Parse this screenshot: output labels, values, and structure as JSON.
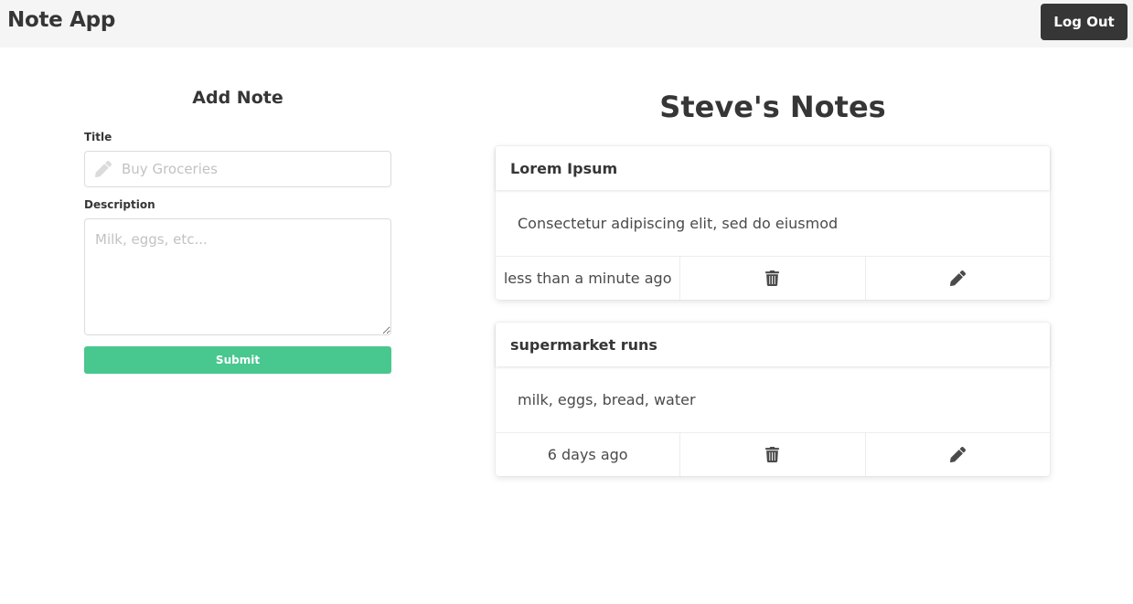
{
  "navbar": {
    "brand": "Note App",
    "logout_label": "Log Out"
  },
  "form": {
    "heading": "Add Note",
    "title_label": "Title",
    "title_placeholder": "Buy Groceries",
    "title_icon": "pencil-icon",
    "description_label": "Description",
    "description_placeholder": "Milk, eggs, etc...",
    "submit_label": "Submit",
    "submit_color": "#48c78e"
  },
  "notes": {
    "heading": "Steve's Notes",
    "items": [
      {
        "title": "Lorem Ipsum",
        "body": "Consectetur adipiscing elit, sed do eiusmod",
        "time": "less than a minute ago",
        "delete_icon": "trash-icon",
        "edit_icon": "pencil-icon"
      },
      {
        "title": "supermarket runs",
        "body": "milk, eggs, bread, water",
        "time": "6 days ago",
        "delete_icon": "trash-icon",
        "edit_icon": "pencil-icon"
      }
    ]
  }
}
